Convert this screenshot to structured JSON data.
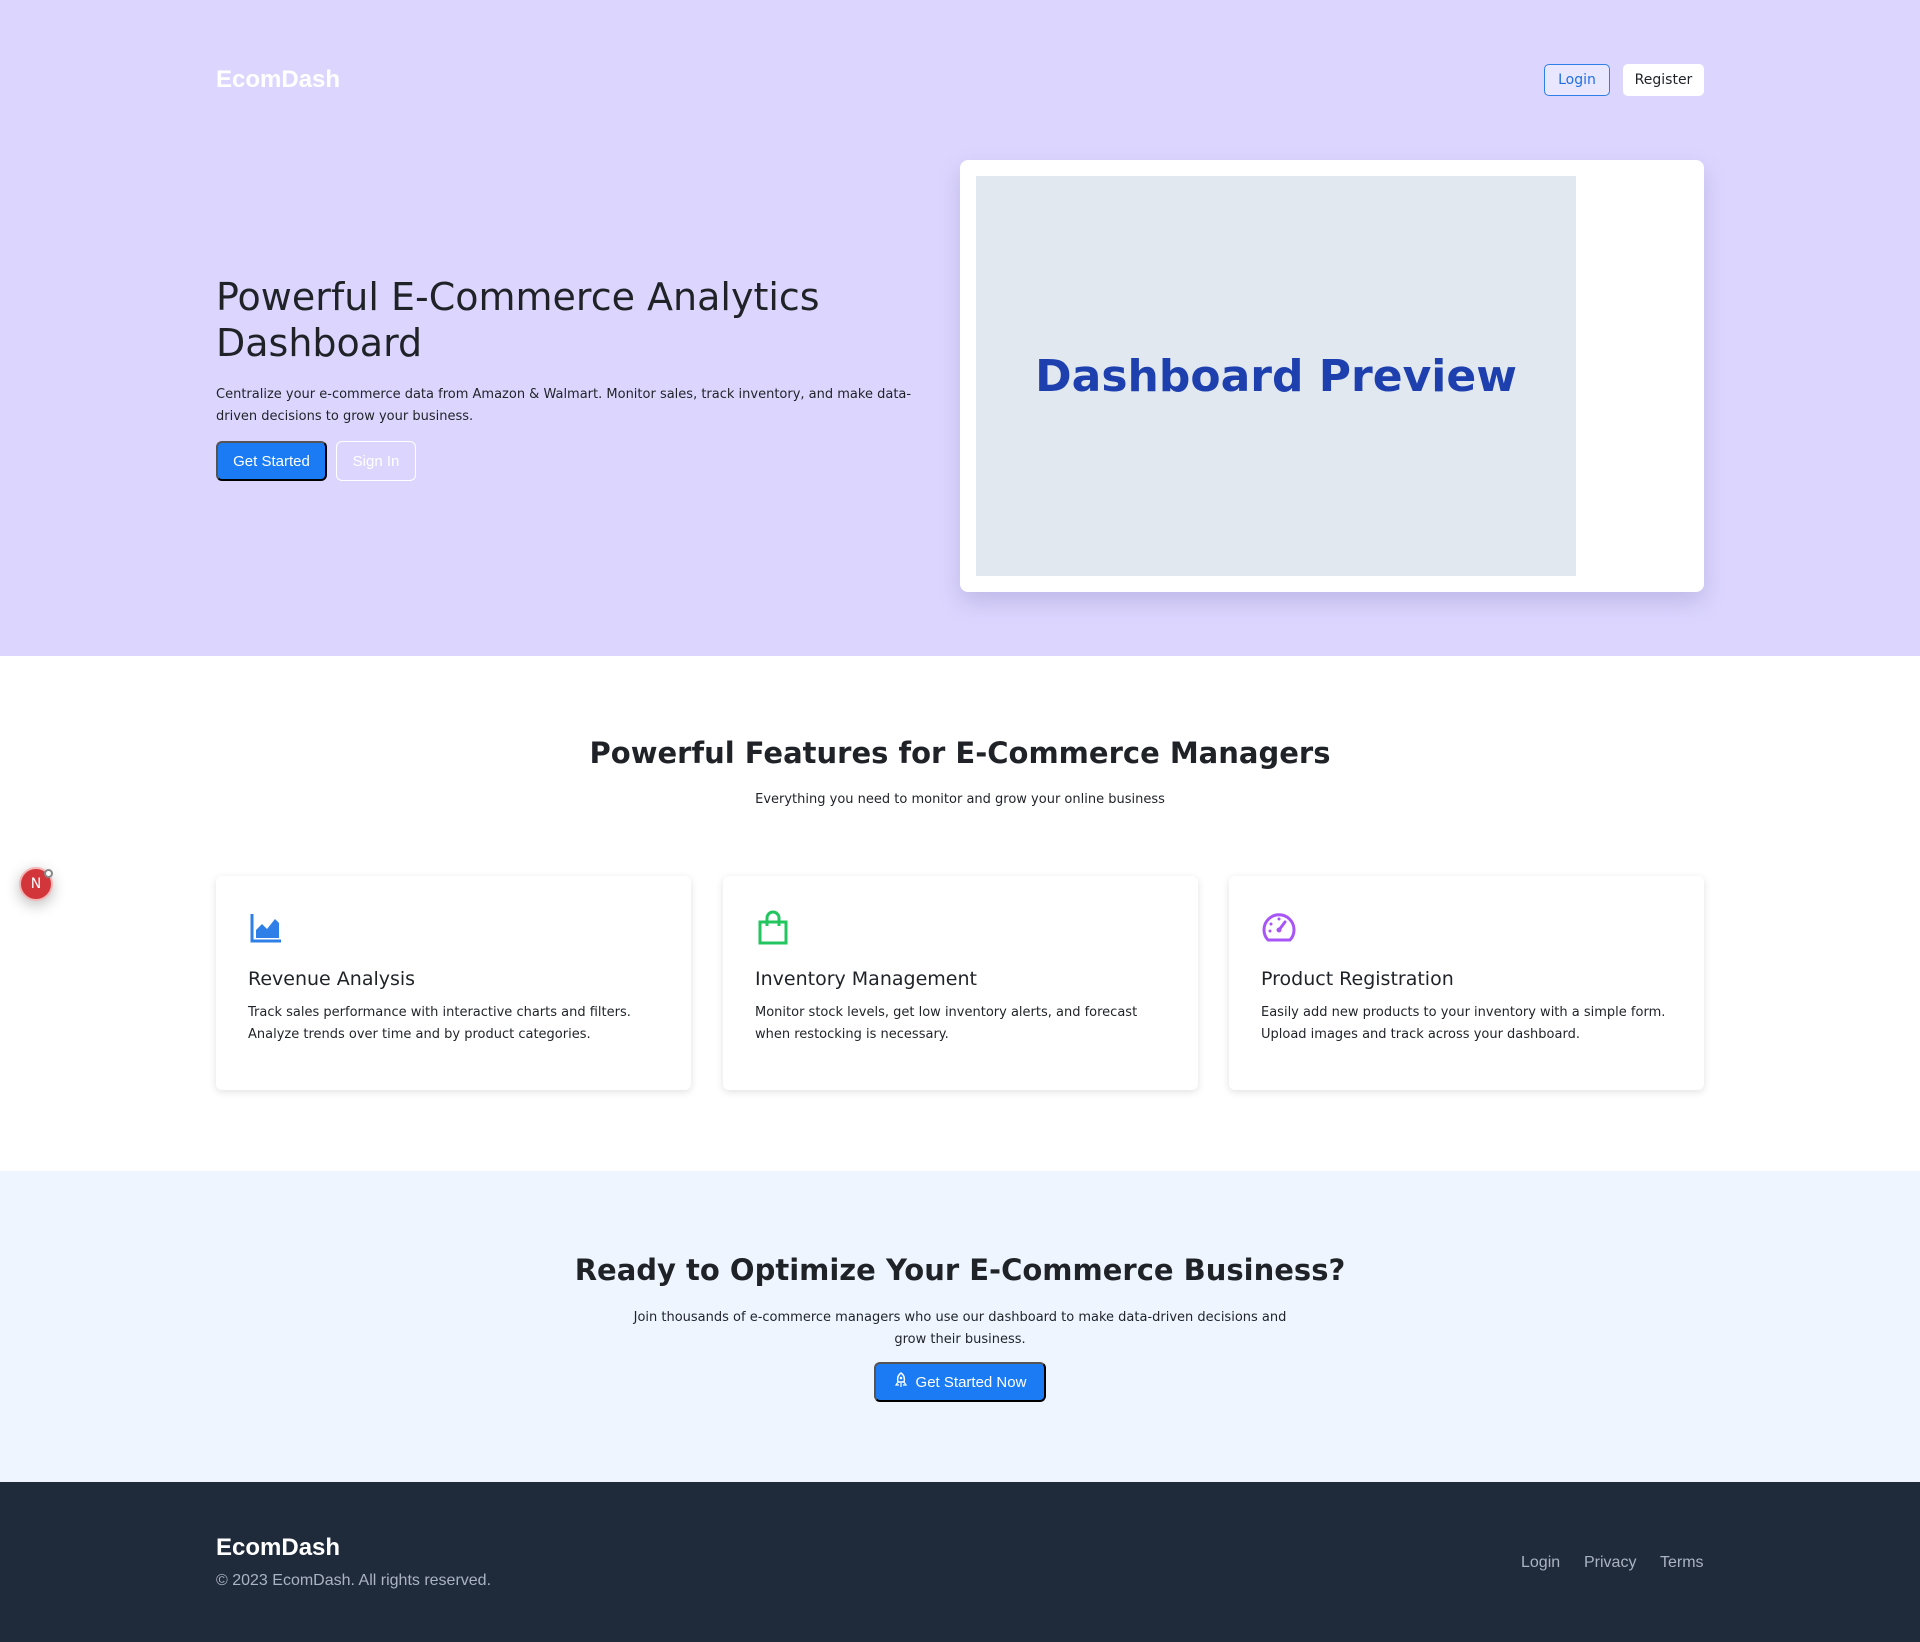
{
  "header": {
    "brand": "EcomDash",
    "login_label": "Login",
    "register_label": "Register"
  },
  "hero": {
    "title": "Powerful E-Commerce Analytics Dashboard",
    "description": "Centralize your e-commerce data from Amazon & Walmart. Monitor sales, track inventory, and make data-driven decisions to grow your business.",
    "primary_button": "Get Started",
    "secondary_button": "Sign In",
    "preview_text": "Dashboard Preview"
  },
  "features": {
    "title": "Powerful Features for E-Commerce Managers",
    "subtitle": "Everything you need to monitor and grow your online business",
    "cards": [
      {
        "icon": "chart-area-icon",
        "icon_color": "#2f7fe8",
        "title": "Revenue Analysis",
        "description": "Track sales performance with interactive charts and filters. Analyze trends over time and by product categories."
      },
      {
        "icon": "shopping-bag-icon",
        "icon_color": "#22c55e",
        "title": "Inventory Management",
        "description": "Monitor stock levels, get low inventory alerts, and forecast when restocking is necessary."
      },
      {
        "icon": "speedometer-icon",
        "icon_color": "#a855f7",
        "title": "Product Registration",
        "description": "Easily add new products to your inventory with a simple form. Upload images and track across your dashboard."
      }
    ]
  },
  "floating_badge": {
    "letter": "N"
  },
  "cta": {
    "title": "Ready to Optimize Your E-Commerce Business?",
    "description": "Join thousands of e-commerce managers who use our dashboard to make data-driven decisions and grow their business.",
    "button_label": "Get Started Now"
  },
  "footer": {
    "brand": "EcomDash",
    "copyright": "© 2023 EcomDash. All rights reserved.",
    "links": [
      "Login",
      "Privacy",
      "Terms"
    ]
  },
  "colors": {
    "hero_bg": "#dcd6ff",
    "primary": "#1a7bf5",
    "cta_bg": "#eef5ff",
    "footer_bg": "#1f2a3b",
    "preview_text": "#1e40af"
  }
}
